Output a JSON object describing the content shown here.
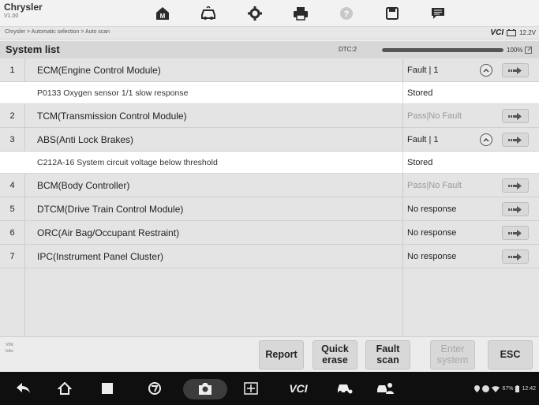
{
  "app": {
    "name": "Chrysler",
    "version": "V1.00"
  },
  "toolbar": {
    "icons": [
      "home-icon",
      "vehicle-icon",
      "settings-icon",
      "print-icon",
      "help-icon",
      "save-icon",
      "message-icon"
    ]
  },
  "breadcrumb": {
    "path": "Chrysler > Automatic selection > Auto scan",
    "vci": "VCI",
    "battery": "12.2V"
  },
  "system_list": {
    "title": "System list",
    "dtc": "DTC:2",
    "progress_fraction": 1.0,
    "progress_label": "100%"
  },
  "rows": [
    {
      "num": "1",
      "module": "ECM(Engine Control Module)",
      "status": "Fault | 1"
    },
    {
      "num": "2",
      "module": "TCM(Transmission Control Module)",
      "status": "Pass|No Fault"
    },
    {
      "num": "3",
      "module": "ABS(Anti Lock Brakes)",
      "status": "Fault | 1"
    },
    {
      "num": "4",
      "module": "BCM(Body Controller)",
      "status": "Pass|No Fault"
    },
    {
      "num": "5",
      "module": "DTCM(Drive Train Control Module)",
      "status": "No response"
    },
    {
      "num": "6",
      "module": "ORC(Air Bag/Occupant Restraint)",
      "status": "No response"
    },
    {
      "num": "7",
      "module": "IPC(Instrument Panel Cluster)",
      "status": "No response"
    }
  ],
  "details": [
    {
      "code": "P0133 Oxygen sensor 1/1 slow response",
      "status": "Stored"
    },
    {
      "code": "C212A-16 System circuit voltage below threshold",
      "status": "Stored"
    }
  ],
  "footer": {
    "vin_label": "VIN:",
    "info_label": "Info:",
    "buttons": {
      "report": "Report",
      "quick_erase": "Quick erase",
      "fault_scan": "Fault scan",
      "enter_system": "Enter system",
      "esc": "ESC"
    }
  },
  "navbar": {
    "vci": "VCI",
    "battery_text": "67%",
    "time": "12:42"
  },
  "colors": {
    "navbar": "#0f0f0f",
    "row": "#e4e4e4",
    "detail_row": "#ffffff",
    "header": "#d7d7d7"
  }
}
